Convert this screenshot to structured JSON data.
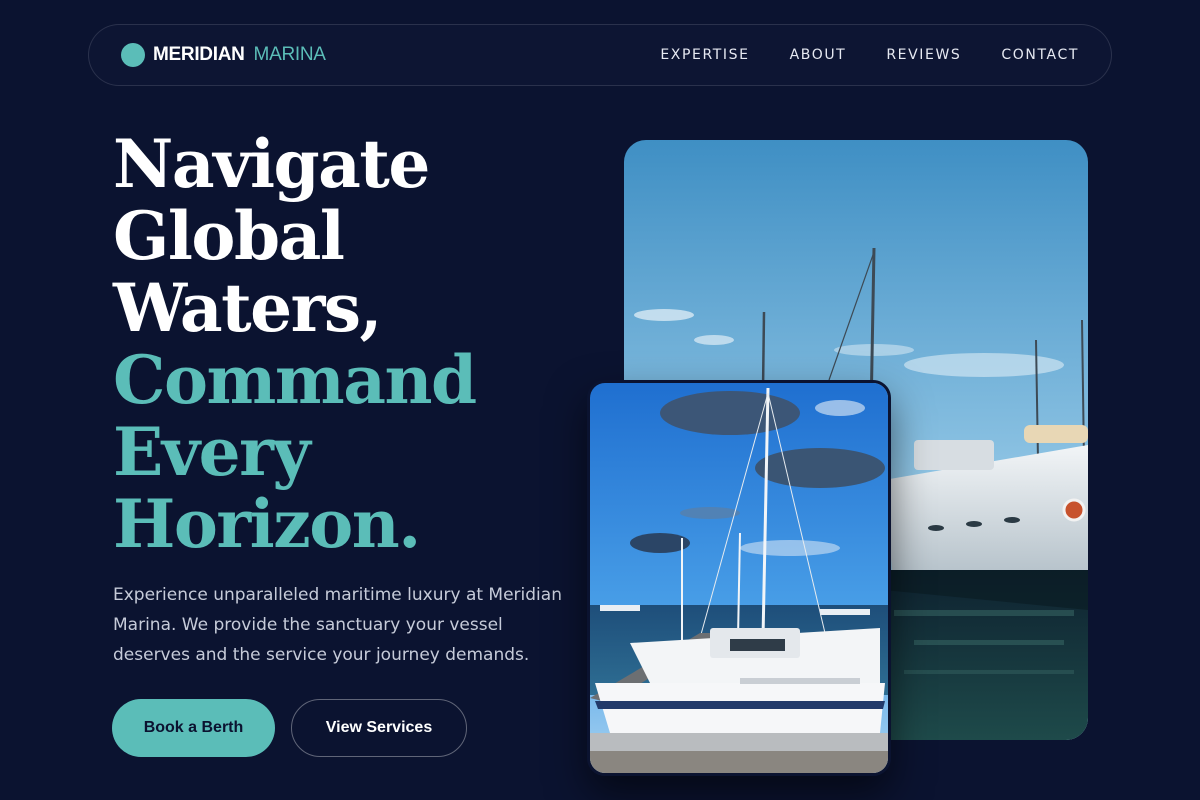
{
  "nav": {
    "brand_primary": "MERIDIAN",
    "brand_secondary": "MARINA",
    "links": [
      {
        "label": "EXPERTISE"
      },
      {
        "label": "ABOUT"
      },
      {
        "label": "REVIEWS"
      },
      {
        "label": "CONTACT"
      }
    ]
  },
  "hero": {
    "title_white": [
      "Navigate",
      "Global",
      "Waters,"
    ],
    "title_teal": [
      "Command",
      "Every",
      "Horizon."
    ],
    "description": "Experience unparalleled maritime luxury at Meridian Marina. We provide the sanctuary your vessel deserves and the service your journey demands.",
    "primary_cta": "Book a Berth",
    "secondary_cta": "View Services"
  },
  "colors": {
    "background": "#0b1330",
    "accent": "#5bbdb8",
    "text": "#ffffff",
    "muted_text": "#c6cbd9"
  },
  "images": {
    "back": "marina-yachts-photo",
    "front": "sailboat-dock-photo"
  }
}
